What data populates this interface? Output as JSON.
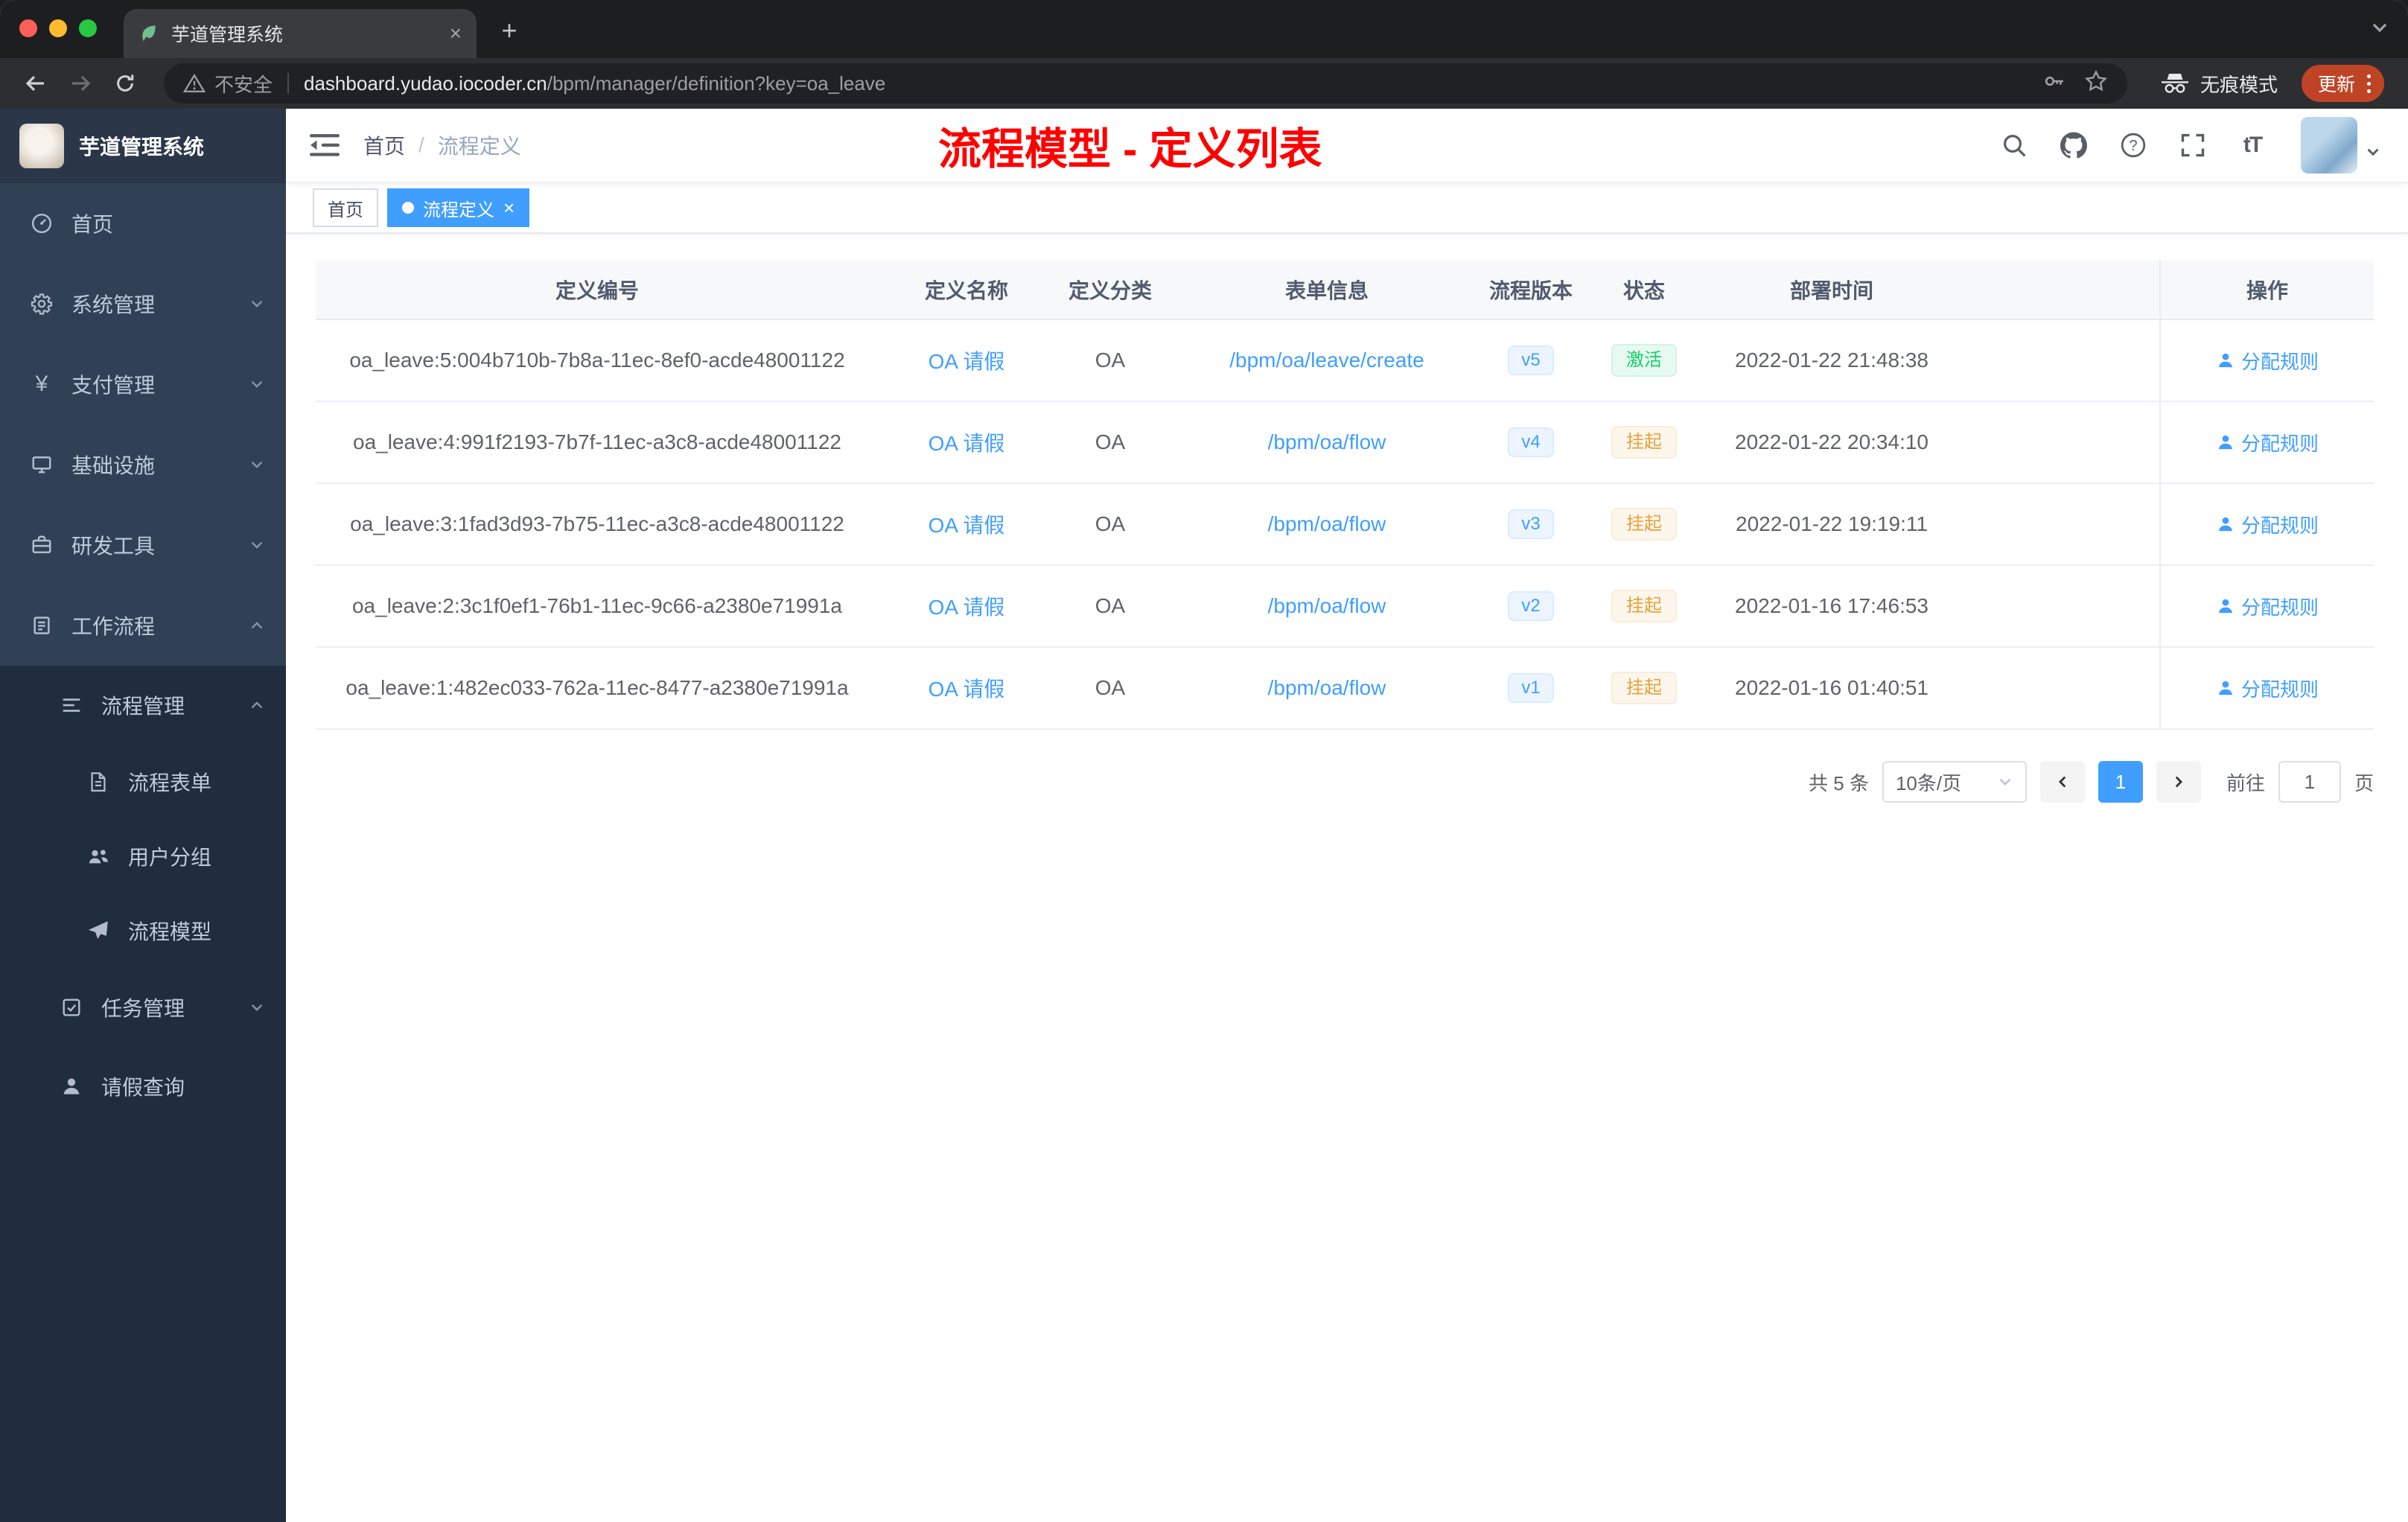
{
  "colors": {
    "accent": "#409eff",
    "success": "#13ce66",
    "warning": "#e6a23c",
    "annotation_red": "#ff0000",
    "sidebar_bg": "#304156",
    "sidebar_sub_bg": "#1f2d3d",
    "active_tag_bg": "#409eff",
    "update_chip_bg": "#bf4426"
  },
  "browser": {
    "tab_title": "芋道管理系统",
    "security_label": "不安全",
    "url_host": "dashboard.yudao.iocoder.cn",
    "url_path": "/bpm/manager/definition?key=oa_leave",
    "incognito_label": "无痕模式",
    "update_label": "更新"
  },
  "sidebar": {
    "logo_title": "芋道管理系统",
    "items": [
      {
        "key": "home",
        "icon": "dashboard-icon",
        "label": "首页",
        "arrow": ""
      },
      {
        "key": "system",
        "icon": "gear-icon",
        "label": "系统管理",
        "arrow": "down"
      },
      {
        "key": "payment",
        "icon": "yen-icon",
        "label": "支付管理",
        "arrow": "down"
      },
      {
        "key": "infrastructure",
        "icon": "infrastructure-icon",
        "label": "基础设施",
        "arrow": "down"
      },
      {
        "key": "devtools",
        "icon": "tools-icon",
        "label": "研发工具",
        "arrow": "down"
      },
      {
        "key": "workflow",
        "icon": "workflow-icon",
        "label": "工作流程",
        "arrow": "up"
      }
    ],
    "sub_items": [
      {
        "key": "process-manage",
        "icon": "process-manage-icon",
        "label": "流程管理",
        "arrow": "up",
        "level": 1
      },
      {
        "key": "process-form",
        "icon": "form-icon",
        "label": "流程表单",
        "arrow": "",
        "level": 2
      },
      {
        "key": "user-group",
        "icon": "user-group-icon",
        "label": "用户分组",
        "arrow": "",
        "level": 2
      },
      {
        "key": "process-model",
        "icon": "process-model-icon",
        "label": "流程模型",
        "arrow": "",
        "level": 2
      },
      {
        "key": "task-manage",
        "icon": "task-icon",
        "label": "任务管理",
        "arrow": "down",
        "level": 1
      },
      {
        "key": "leave-query",
        "icon": "user-icon",
        "label": "请假查询",
        "arrow": "",
        "level": 1
      }
    ]
  },
  "header": {
    "breadcrumb": {
      "home": "首页",
      "separator": "/",
      "current": "流程定义"
    },
    "annotation": "流程模型 - 定义列表"
  },
  "tags": [
    {
      "label": "首页",
      "active": false,
      "closable": false
    },
    {
      "label": "流程定义",
      "active": true,
      "closable": true
    }
  ],
  "table": {
    "columns": [
      "定义编号",
      "定义名称",
      "定义分类",
      "表单信息",
      "流程版本",
      "状态",
      "部署时间",
      "操作"
    ],
    "rows": [
      {
        "id": "oa_leave:5:004b710b-7b8a-11ec-8ef0-acde48001122",
        "name": "OA 请假",
        "category": "OA",
        "form": "/bpm/oa/leave/create",
        "version": "v5",
        "status": "激活",
        "status_type": "success",
        "time": "2022-01-22 21:48:38",
        "action": "分配规则"
      },
      {
        "id": "oa_leave:4:991f2193-7b7f-11ec-a3c8-acde48001122",
        "name": "OA 请假",
        "category": "OA",
        "form": "/bpm/oa/flow",
        "version": "v4",
        "status": "挂起",
        "status_type": "warning",
        "time": "2022-01-22 20:34:10",
        "action": "分配规则"
      },
      {
        "id": "oa_leave:3:1fad3d93-7b75-11ec-a3c8-acde48001122",
        "name": "OA 请假",
        "category": "OA",
        "form": "/bpm/oa/flow",
        "version": "v3",
        "status": "挂起",
        "status_type": "warning",
        "time": "2022-01-22 19:19:11",
        "action": "分配规则"
      },
      {
        "id": "oa_leave:2:3c1f0ef1-76b1-11ec-9c66-a2380e71991a",
        "name": "OA 请假",
        "category": "OA",
        "form": "/bpm/oa/flow",
        "version": "v2",
        "status": "挂起",
        "status_type": "warning",
        "time": "2022-01-16 17:46:53",
        "action": "分配规则"
      },
      {
        "id": "oa_leave:1:482ec033-762a-11ec-8477-a2380e71991a",
        "name": "OA 请假",
        "category": "OA",
        "form": "/bpm/oa/flow",
        "version": "v1",
        "status": "挂起",
        "status_type": "warning",
        "time": "2022-01-16 01:40:51",
        "action": "分配规则"
      }
    ]
  },
  "pagination": {
    "total": "共 5 条",
    "page_size": "10条/页",
    "current": "1",
    "goto": "前往",
    "goto_value": "1",
    "page_unit": "页"
  }
}
